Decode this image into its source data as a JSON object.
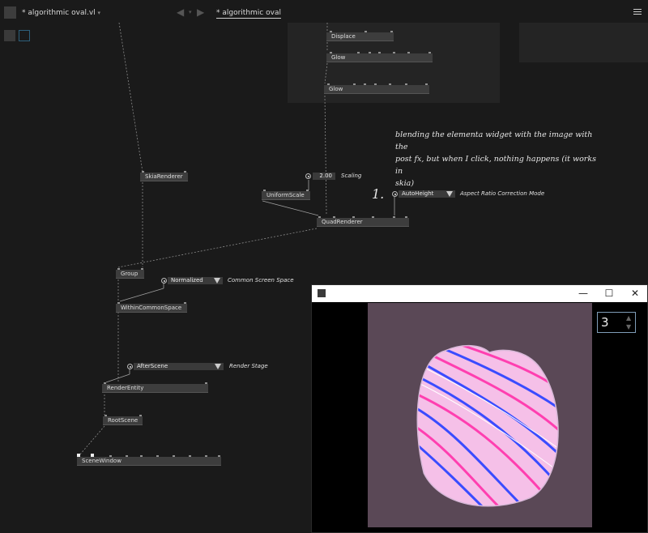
{
  "titlebar": {
    "file_tab": "* algorithmic oval.vl",
    "file_tab_chevron": "▾",
    "back_arrow": "◀",
    "arrow_chevron": "▾",
    "forward_arrow": "▶",
    "active_patch_tab": "* algorithmic oval"
  },
  "nodes": {
    "displace": "Displace",
    "glow1": "Glow",
    "glow2": "Glow",
    "skia_renderer": "SkiaRenderer",
    "uniform_scale": "UniformScale",
    "quad_renderer": "QuadRenderer",
    "group": "Group",
    "within_common_space": "WithinCommonSpace",
    "render_entity": "RenderEntity",
    "root_scene": "RootScene",
    "scene_window": "SceneWindow"
  },
  "pads": {
    "scaling_value": "2.00",
    "aspect_mode": "AutoHeight",
    "common_space": "Normalized",
    "render_stage": "AfterScene"
  },
  "comments": {
    "scaling": "Scaling",
    "aspect": "Aspect Ratio Correction Mode",
    "common_space": "Common Screen Space",
    "render_stage": "Render Stage",
    "step_number": "1.",
    "note_line1": "blending the elementa widget with the image with the",
    "note_line2": "post fx, but when I click, nothing happens (it works in",
    "note_line3": "skia)"
  },
  "render_window": {
    "minimize": "—",
    "maximize": "☐",
    "close": "✕",
    "stepper_value": "3",
    "stepper_up": "▲",
    "stepper_down": "▼"
  },
  "colors": {
    "background": "#1a1a1a",
    "node": "#3d3d3d",
    "canvas": "#5a4856",
    "accent_pink": "#ff3fb0",
    "accent_blue": "#3a4cff"
  }
}
